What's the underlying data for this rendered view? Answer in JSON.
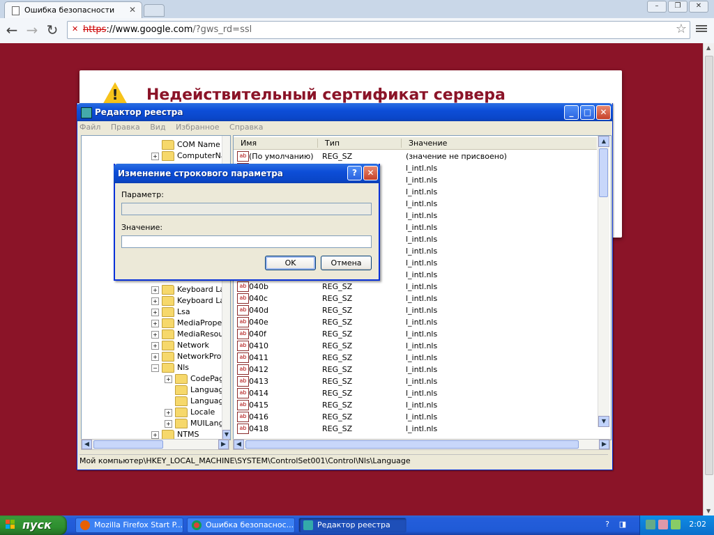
{
  "browser": {
    "tab_title": "Ошибка безопасности",
    "url_proto": "https",
    "url_host": "://www.google.com",
    "url_rest": "/?gws_rd=ssl",
    "page_heading": "Недействительный сертификат сервера",
    "bg_color": "#8b1428"
  },
  "regedit": {
    "title": "Редактор реестра",
    "menu": [
      "Файл",
      "Правка",
      "Вид",
      "Избранное",
      "Справка"
    ],
    "tree_items": [
      {
        "label": "COM Name A",
        "toggle": "",
        "indent": 1
      },
      {
        "label": "ComputerNa",
        "toggle": "+",
        "indent": 1
      },
      {
        "label": "Keyboard La",
        "toggle": "+",
        "indent": 1
      },
      {
        "label": "Keyboard La",
        "toggle": "+",
        "indent": 1
      },
      {
        "label": "Lsa",
        "toggle": "+",
        "indent": 1
      },
      {
        "label": "MediaProper",
        "toggle": "+",
        "indent": 1
      },
      {
        "label": "MediaResou",
        "toggle": "+",
        "indent": 1
      },
      {
        "label": "Network",
        "toggle": "+",
        "indent": 1
      },
      {
        "label": "NetworkProv",
        "toggle": "+",
        "indent": 1
      },
      {
        "label": "Nls",
        "toggle": "−",
        "indent": 1
      },
      {
        "label": "CodePag",
        "toggle": "+",
        "indent": 2
      },
      {
        "label": "Languag",
        "toggle": "",
        "indent": 2
      },
      {
        "label": "Languag",
        "toggle": "",
        "indent": 2
      },
      {
        "label": "Locale",
        "toggle": "+",
        "indent": 2
      },
      {
        "label": "MUILang",
        "toggle": "+",
        "indent": 2
      },
      {
        "label": "NTMS",
        "toggle": "+",
        "indent": 1
      }
    ],
    "columns": {
      "name": "Имя",
      "type": "Тип",
      "value": "Значение"
    },
    "rows": [
      {
        "name": "(По умолчанию)",
        "type": "REG_SZ",
        "value": "(значение не присвоено)"
      },
      {
        "name": "",
        "type": "",
        "value": "l_intl.nls"
      },
      {
        "name": "",
        "type": "",
        "value": "l_intl.nls"
      },
      {
        "name": "",
        "type": "",
        "value": "l_intl.nls"
      },
      {
        "name": "",
        "type": "",
        "value": "l_intl.nls"
      },
      {
        "name": "",
        "type": "",
        "value": "l_intl.nls"
      },
      {
        "name": "",
        "type": "",
        "value": "l_intl.nls"
      },
      {
        "name": "",
        "type": "",
        "value": "l_intl.nls"
      },
      {
        "name": "",
        "type": "",
        "value": "l_intl.nls"
      },
      {
        "name": "",
        "type": "",
        "value": "l_intl.nls"
      },
      {
        "name": "",
        "type": "",
        "value": "l_intl.nls"
      },
      {
        "name": "040b",
        "type": "REG_SZ",
        "value": "l_intl.nls"
      },
      {
        "name": "040c",
        "type": "REG_SZ",
        "value": "l_intl.nls"
      },
      {
        "name": "040d",
        "type": "REG_SZ",
        "value": "l_intl.nls"
      },
      {
        "name": "040e",
        "type": "REG_SZ",
        "value": "l_intl.nls"
      },
      {
        "name": "040f",
        "type": "REG_SZ",
        "value": "l_intl.nls"
      },
      {
        "name": "0410",
        "type": "REG_SZ",
        "value": "l_intl.nls"
      },
      {
        "name": "0411",
        "type": "REG_SZ",
        "value": "l_intl.nls"
      },
      {
        "name": "0412",
        "type": "REG_SZ",
        "value": "l_intl.nls"
      },
      {
        "name": "0413",
        "type": "REG_SZ",
        "value": "l_intl.nls"
      },
      {
        "name": "0414",
        "type": "REG_SZ",
        "value": "l_intl.nls"
      },
      {
        "name": "0415",
        "type": "REG_SZ",
        "value": "l_intl.nls"
      },
      {
        "name": "0416",
        "type": "REG_SZ",
        "value": "l_intl.nls"
      },
      {
        "name": "0418",
        "type": "REG_SZ",
        "value": "l_intl.nls"
      }
    ],
    "status_path": "Мой компьютер\\HKEY_LOCAL_MACHINE\\SYSTEM\\ControlSet001\\Control\\Nls\\Language"
  },
  "dialog": {
    "title": "Изменение строкового параметра",
    "param_label": "Параметр:",
    "param_value": "",
    "value_label": "Значение:",
    "value_value": "",
    "ok_label": "OK",
    "cancel_label": "Отмена"
  },
  "taskbar": {
    "start_label": "пуск",
    "tasks": [
      {
        "label": "Mozilla Firefox Start P...",
        "icon": "firefox-icon"
      },
      {
        "label": "Ошибка безопаснос...",
        "icon": "chrome-icon"
      },
      {
        "label": "Редактор реестра",
        "icon": "regedit-icon"
      }
    ],
    "clock": "2:02"
  }
}
